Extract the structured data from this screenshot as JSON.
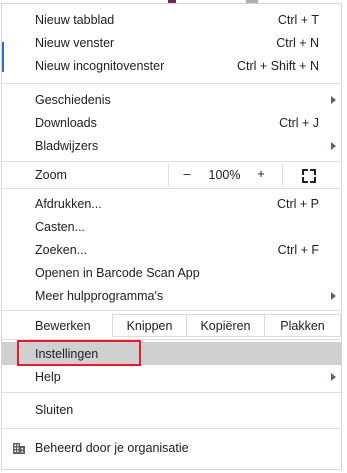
{
  "menu": {
    "sections": [
      [
        {
          "label": "Nieuw tabblad",
          "shortcut": "Ctrl + T"
        },
        {
          "label": "Nieuw venster",
          "shortcut": "Ctrl + N"
        },
        {
          "label": "Nieuw incognitovenster",
          "shortcut": "Ctrl + Shift + N"
        }
      ],
      [
        {
          "label": "Geschiedenis",
          "submenu": true
        },
        {
          "label": "Downloads",
          "shortcut": "Ctrl + J"
        },
        {
          "label": "Bladwijzers",
          "submenu": true
        }
      ],
      [
        {
          "label": "Afdrukken...",
          "shortcut": "Ctrl + P"
        },
        {
          "label": "Casten..."
        },
        {
          "label": "Zoeken...",
          "shortcut": "Ctrl + F"
        },
        {
          "label": "Openen in Barcode Scan App"
        },
        {
          "label": "Meer hulpprogramma's",
          "submenu": true
        }
      ],
      [
        {
          "label": "Instellingen",
          "highlighted": true
        },
        {
          "label": "Help",
          "submenu": true
        }
      ],
      [
        {
          "label": "Sluiten"
        }
      ]
    ],
    "zoom": {
      "label": "Zoom",
      "minus": "–",
      "value": "100%",
      "plus": "+",
      "fullscreen_icon": "fullscreen-icon"
    },
    "edit": {
      "label": "Bewerken",
      "cut": "Knippen",
      "copy": "Kopiëren",
      "paste": "Plakken"
    },
    "managed": {
      "label": "Beheerd door je organisatie",
      "icon": "building-icon"
    }
  },
  "colors": {
    "highlight": "#d0d0d0",
    "annotation": "#e11d2a",
    "accent": "#1a73e8"
  }
}
